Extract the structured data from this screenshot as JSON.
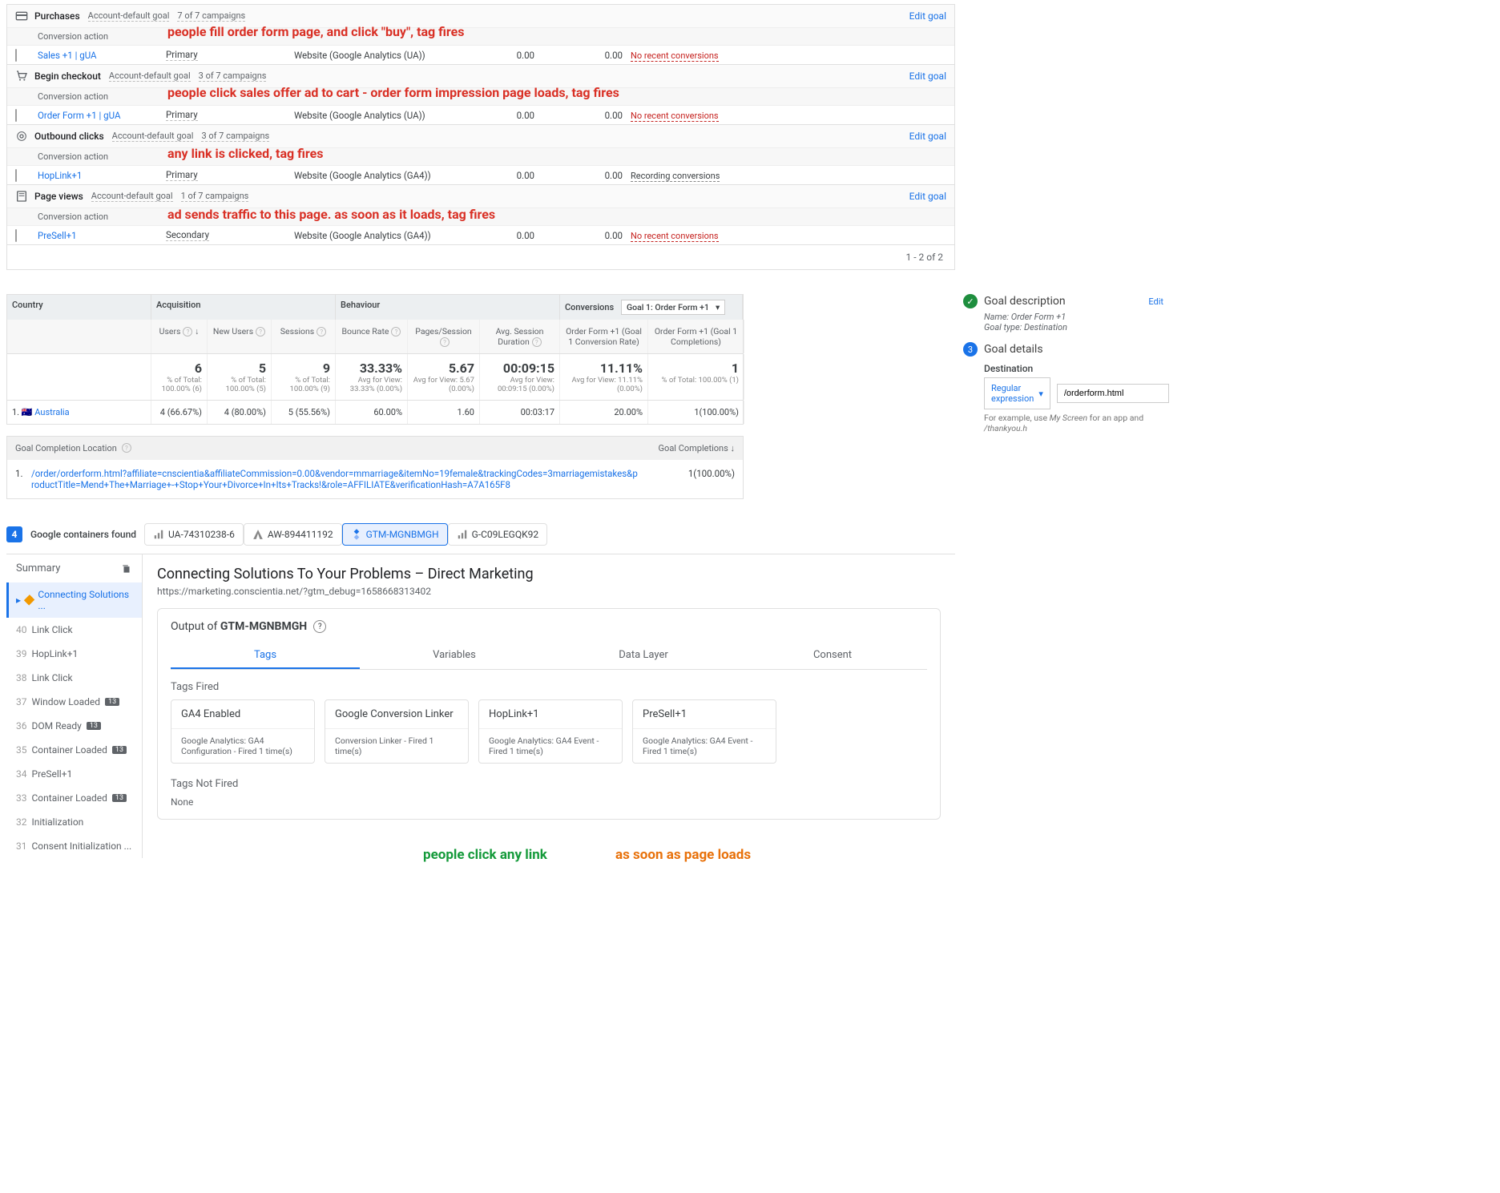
{
  "ads": {
    "edit": "Edit goal",
    "col_conv": "Conversion action",
    "col_prim": "Primary",
    "col_sec": "Secondary",
    "groups": [
      {
        "icon": "purchases",
        "name": "Purchases",
        "meta1": "Account-default goal",
        "meta2": "7 of 7 campaigns",
        "row": {
          "name": "Sales +1 | gUA",
          "opt": "Primary",
          "src": "Website (Google Analytics (UA))",
          "v1": "0.00",
          "v2": "0.00",
          "status": "No recent conversions",
          "bad": true
        }
      },
      {
        "icon": "cart",
        "name": "Begin checkout",
        "meta1": "Account-default goal",
        "meta2": "3 of 7 campaigns",
        "row": {
          "name": "Order Form +1 | gUA",
          "opt": "Primary",
          "src": "Website (Google Analytics (UA))",
          "v1": "0.00",
          "v2": "0.00",
          "status": "No recent conversions",
          "bad": true
        }
      },
      {
        "icon": "click",
        "name": "Outbound clicks",
        "meta1": "Account-default goal",
        "meta2": "3 of 7 campaigns",
        "row": {
          "name": "HopLink+1",
          "opt": "Primary",
          "src": "Website (Google Analytics (GA4))",
          "v1": "0.00",
          "v2": "0.00",
          "status": "Recording conversions",
          "bad": false
        }
      },
      {
        "icon": "page",
        "name": "Page views",
        "meta1": "Account-default goal",
        "meta2": "1 of 7 campaigns",
        "row": {
          "name": "PreSell+1",
          "opt": "Secondary",
          "src": "Website (Google Analytics (GA4))",
          "v1": "0.00",
          "v2": "0.00",
          "status": "No recent conversions",
          "bad": true
        }
      }
    ],
    "footer": "1 - 2 of 2"
  },
  "annotations": {
    "a1": "people fill order form page, and click \"buy\", tag fires",
    "a2": "people click sales offer ad to cart - order form impression page loads, tag fires",
    "a3": "any link is clicked, tag fires",
    "a4": "ad sends traffic to this page. as soon as it loads, tag fires",
    "b1": "people click any link",
    "b2": "as soon as page loads"
  },
  "ga": {
    "grp_country": "Country",
    "grp_acq": "Acquisition",
    "grp_beh": "Behaviour",
    "grp_conv": "Conversions",
    "conv_dd": "Goal 1: Order Form +1",
    "cols": {
      "users": "Users",
      "newusers": "New Users",
      "sessions": "Sessions",
      "bounce": "Bounce Rate",
      "pps": "Pages/Session",
      "asd": "Avg. Session Duration",
      "g1r": "Order Form +1 (Goal 1 Conversion Rate)",
      "g1c": "Order Form +1 (Goal 1 Completions)"
    },
    "totals": {
      "users": "6",
      "users_s": "% of Total: 100.00% (6)",
      "newusers": "5",
      "newusers_s": "% of Total: 100.00% (5)",
      "sessions": "9",
      "sessions_s": "% of Total: 100.00% (9)",
      "bounce": "33.33%",
      "bounce_s": "Avg for View: 33.33% (0.00%)",
      "pps": "5.67",
      "pps_s": "Avg for View: 5.67 (0.00%)",
      "asd": "00:09:15",
      "asd_s": "Avg for View: 00:09:15 (0.00%)",
      "g1r": "11.11%",
      "g1r_s": "Avg for View: 11.11% (0.00%)",
      "g1c": "1",
      "g1c_s": "% of Total: 100.00% (1)"
    },
    "row": {
      "idx": "1.",
      "flag": "🇦🇺",
      "country": "Australia",
      "users": "4 (66.67%)",
      "newusers": "4 (80.00%)",
      "sessions": "5 (55.56%)",
      "bounce": "60.00%",
      "pps": "1.60",
      "asd": "00:03:17",
      "g1r": "20.00%",
      "g1c": "1(100.00%)"
    }
  },
  "goalloc": {
    "h": "Goal Completion Location",
    "hc": "Goal Completions",
    "idx": "1.",
    "url": "/order/orderform.html?affiliate=cnscientia&affiliateCommission=0.00&vendor=mmarriage&itemNo=19female&trackingCodes=3marriagemistakes&productTitle=Mend+The+Marriage+-+Stop+Your+Divorce+In+Its+Tracks!&role=AFFILIATE&verificationHash=A7A165F8",
    "val": "1(100.00%)"
  },
  "goalsetup": {
    "s1": "Goal description",
    "edit": "Edit",
    "name_l": "Name:",
    "name_v": "Order Form +1",
    "type_l": "Goal type:",
    "type_v": "Destination",
    "s2": "Goal details",
    "dest": "Destination",
    "regex": "Regular expression",
    "input": "/orderform.html",
    "hint_pre": "For example, use ",
    "hint_em": "My Screen",
    "hint_mid": " for an app and ",
    "hint_em2": "/thankyou.h"
  },
  "ta": {
    "count": "4",
    "found": "Google containers found",
    "containers": [
      {
        "id": "UA-74310238-6",
        "icon": "ua"
      },
      {
        "id": "AW-894411192",
        "icon": "aw"
      },
      {
        "id": "GTM-MGNBMGH",
        "icon": "gtm",
        "active": true
      },
      {
        "id": "G-C09LEGQK92",
        "icon": "ga4"
      }
    ],
    "summary": "Summary",
    "events": [
      {
        "t": "Connecting Solutions ...",
        "diam": true,
        "active": true
      },
      {
        "n": "40",
        "t": "Link Click"
      },
      {
        "n": "39",
        "t": "HopLink+1"
      },
      {
        "n": "38",
        "t": "Link Click"
      },
      {
        "n": "37",
        "t": "Window Loaded",
        "c": "13"
      },
      {
        "n": "36",
        "t": "DOM Ready",
        "c": "13"
      },
      {
        "n": "35",
        "t": "Container Loaded",
        "c": "13"
      },
      {
        "n": "34",
        "t": "PreSell+1"
      },
      {
        "n": "33",
        "t": "Container Loaded",
        "c": "13"
      },
      {
        "n": "32",
        "t": "Initialization"
      },
      {
        "n": "31",
        "t": "Consent Initialization ..."
      }
    ],
    "main": {
      "title": "Connecting Solutions To Your Problems – Direct Marketing",
      "url": "https://marketing.conscientia.net/?gtm_debug=1658668313402",
      "output_l": "Output of ",
      "output_v": "GTM-MGNBMGH",
      "tabs": [
        "Tags",
        "Variables",
        "Data Layer",
        "Consent"
      ],
      "fired": "Tags Fired",
      "notfired": "Tags Not Fired",
      "none": "None",
      "tiles": [
        {
          "n": "GA4 Enabled",
          "m": "Google Analytics: GA4 Configuration - Fired 1 time(s)"
        },
        {
          "n": "Google Conversion Linker",
          "m": "Conversion Linker - Fired 1 time(s)"
        },
        {
          "n": "HopLink+1",
          "m": "Google Analytics: GA4 Event - Fired 1 time(s)"
        },
        {
          "n": "PreSell+1",
          "m": "Google Analytics: GA4 Event - Fired 1 time(s)"
        }
      ]
    }
  }
}
